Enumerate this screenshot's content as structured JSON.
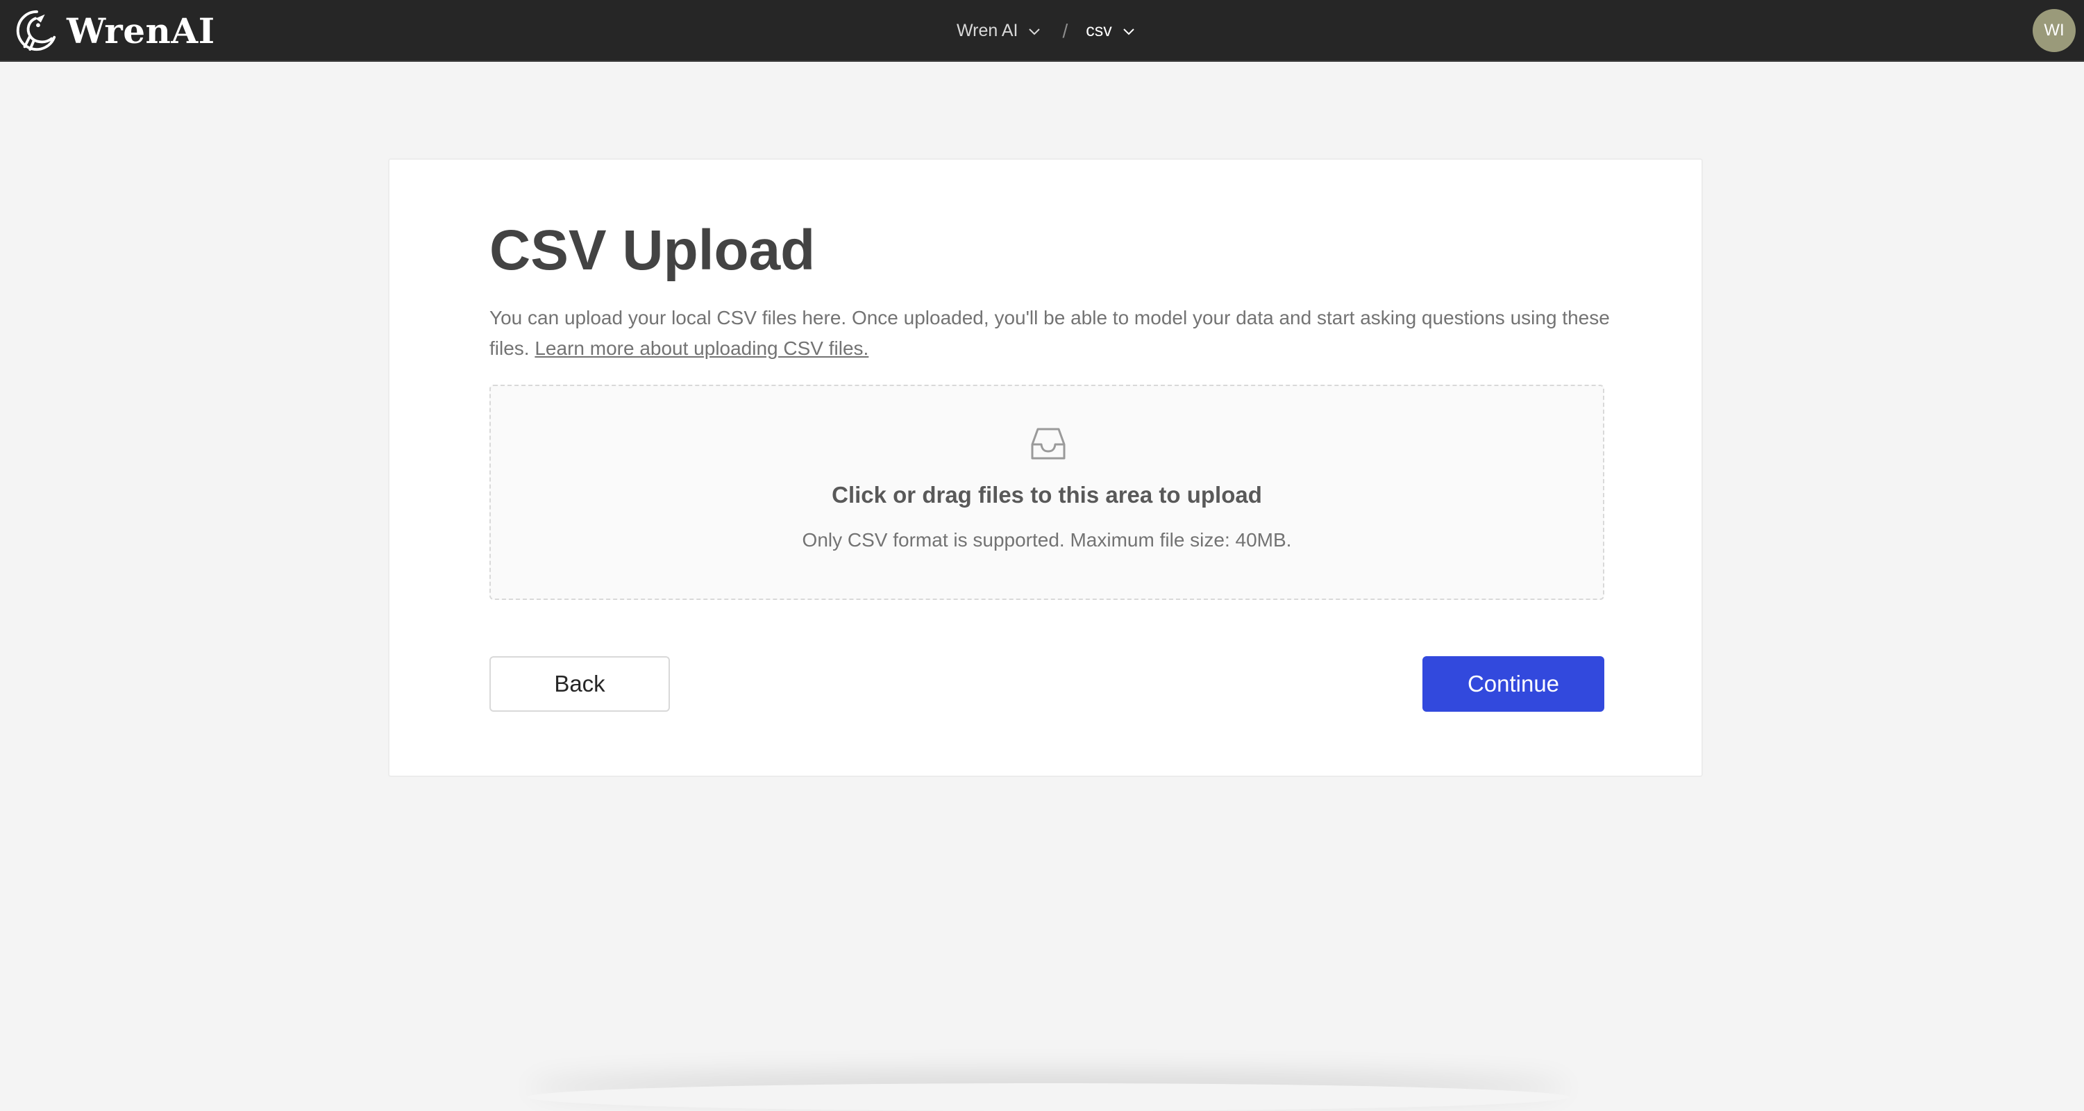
{
  "app": {
    "name": "WrenAI",
    "brand_color": "#262626",
    "accent_color": "#3249dd"
  },
  "header": {
    "breadcrumbs": [
      {
        "label": "Wren AI",
        "icon": "chevron-down-icon"
      },
      {
        "label": "csv",
        "icon": "chevron-down-icon"
      }
    ],
    "separator": "/",
    "avatar_initials": "WI"
  },
  "main": {
    "title": "CSV Upload",
    "description": "You can upload your local CSV files here. Once uploaded, you'll be able to model your data and start asking questions using these files.",
    "learn_more_link": "Learn more about uploading CSV files.",
    "dropzone": {
      "icon": "inbox-icon",
      "text": "Click or drag files to this area to upload",
      "hint": "Only CSV format is supported. Maximum file size: 40MB."
    },
    "back_label": "Back",
    "continue_label": "Continue"
  }
}
